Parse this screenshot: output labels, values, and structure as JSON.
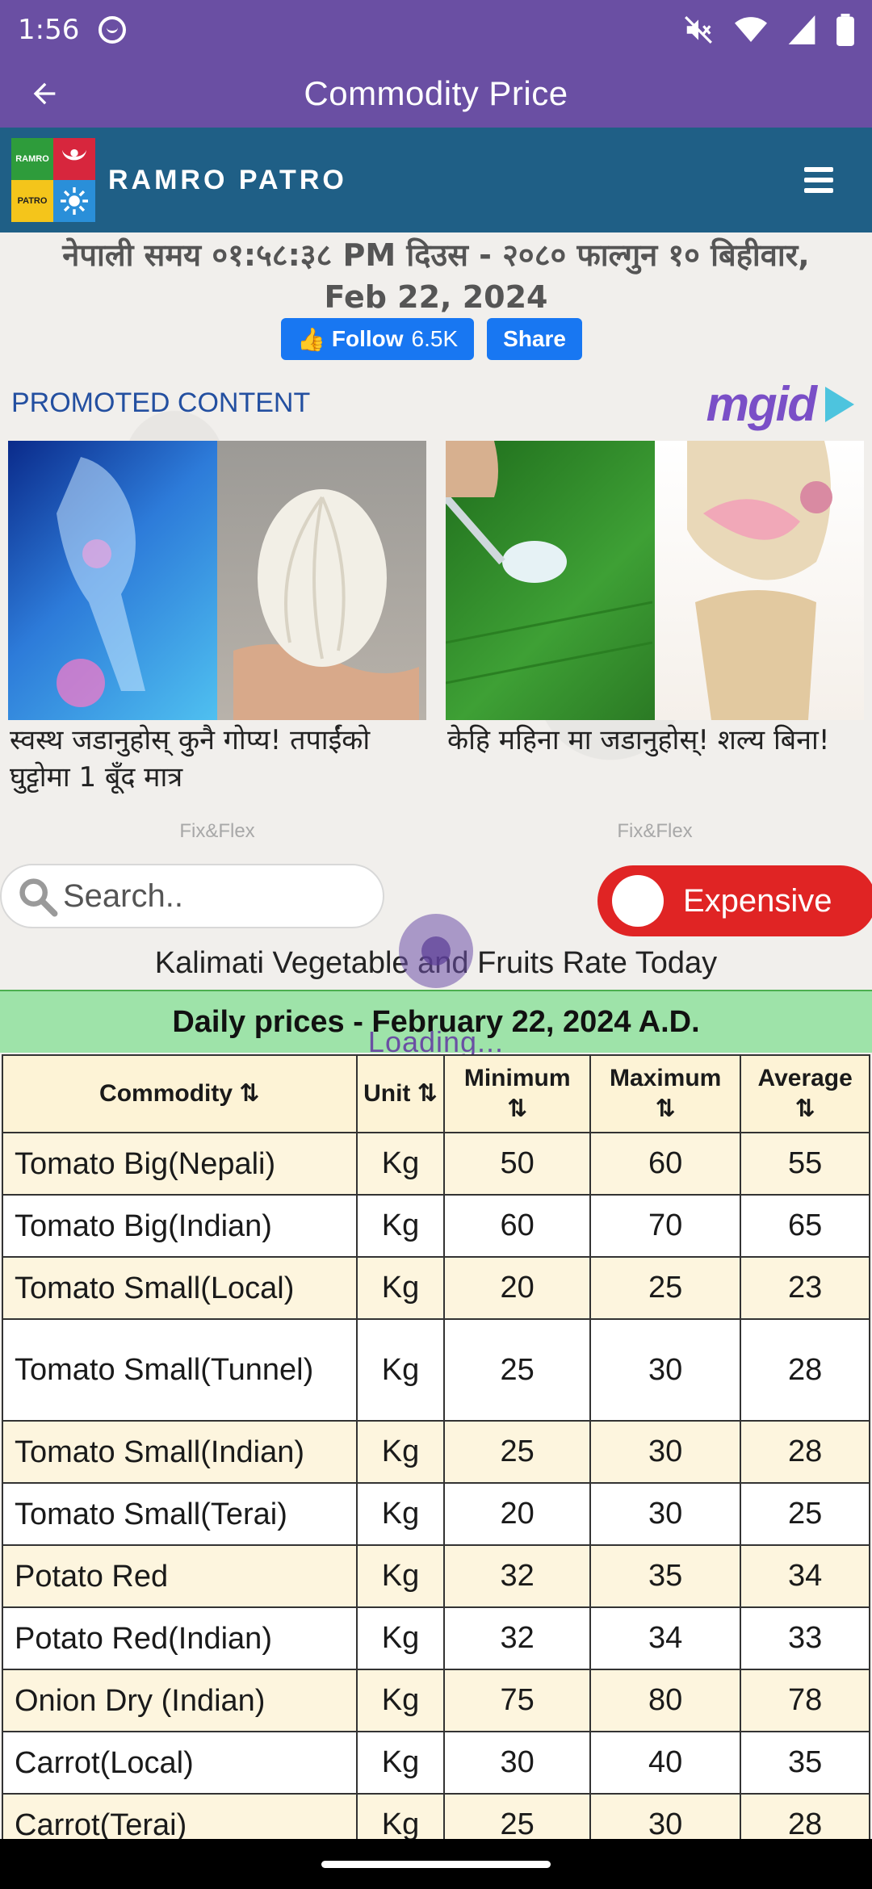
{
  "status": {
    "time": "1:56"
  },
  "appbar": {
    "title": "Commodity Price"
  },
  "site": {
    "name": "RAMRO PATRO",
    "logo_text_top": "RAMRO",
    "logo_text_bottom": "PATRO"
  },
  "date": {
    "line1": "नेपाली समय ०१:५८:३८ PM  दिउस  - २०८० फाल्गुन १० बिहीवार,",
    "line2": "Feb 22, 2024"
  },
  "social": {
    "follow_label": "Follow",
    "follow_count": "6.5K",
    "share_label": "Share"
  },
  "promoted": {
    "label": "PROMOTED CONTENT",
    "brand": "mgid",
    "ads": [
      {
        "caption": "स्वस्थ जडानुहोस् कुनै गोप्य! तपाईंको घुट्टोमा 1 बूँद मात्र",
        "source": "Fix&Flex"
      },
      {
        "caption": "केहि महिना मा जडानुहोस्! शल्य बिना!",
        "source": "Fix&Flex"
      }
    ]
  },
  "search": {
    "placeholder": "Search.."
  },
  "toggle": {
    "label": "Expensive"
  },
  "caption": "Kalimati Vegetable and Fruits Rate Today",
  "daily_title": "Daily prices - February 22, 2024 A.D.",
  "loading": "Loading...",
  "table": {
    "headers": [
      "Commodity ⇅",
      "Unit ⇅",
      "Minimum ⇅",
      "Maximum ⇅",
      "Average ⇅"
    ],
    "header_labels": {
      "commodity": "Commodity",
      "unit": "Unit",
      "min": "Minimum",
      "max": "Maximum",
      "avg": "Average",
      "sort": "⇅"
    },
    "rows": [
      {
        "name": "Tomato Big(Nepali)",
        "unit": "Kg",
        "min": "50",
        "max": "60",
        "avg": "55"
      },
      {
        "name": "Tomato Big(Indian)",
        "unit": "Kg",
        "min": "60",
        "max": "70",
        "avg": "65"
      },
      {
        "name": "Tomato Small(Local)",
        "unit": "Kg",
        "min": "20",
        "max": "25",
        "avg": "23"
      },
      {
        "name": "Tomato Small(Tunnel)",
        "unit": "Kg",
        "min": "25",
        "max": "30",
        "avg": "28"
      },
      {
        "name": "Tomato Small(Indian)",
        "unit": "Kg",
        "min": "25",
        "max": "30",
        "avg": "28"
      },
      {
        "name": "Tomato Small(Terai)",
        "unit": "Kg",
        "min": "20",
        "max": "30",
        "avg": "25"
      },
      {
        "name": "Potato Red",
        "unit": "Kg",
        "min": "32",
        "max": "35",
        "avg": "34"
      },
      {
        "name": "Potato Red(Indian)",
        "unit": "Kg",
        "min": "32",
        "max": "34",
        "avg": "33"
      },
      {
        "name": "Onion Dry (Indian)",
        "unit": "Kg",
        "min": "75",
        "max": "80",
        "avg": "78"
      },
      {
        "name": "Carrot(Local)",
        "unit": "Kg",
        "min": "30",
        "max": "40",
        "avg": "35"
      },
      {
        "name": "Carrot(Terai)",
        "unit": "Kg",
        "min": "25",
        "max": "30",
        "avg": "28"
      }
    ]
  },
  "colors": {
    "appbar": "#6a4fa3",
    "site_header": "#1f5f86",
    "toggle": "#e02424",
    "daily_header": "#9ee3a9",
    "table_header": "#fdf3d6",
    "row_alt": "#fdf5de",
    "facebook": "#1877f2"
  }
}
